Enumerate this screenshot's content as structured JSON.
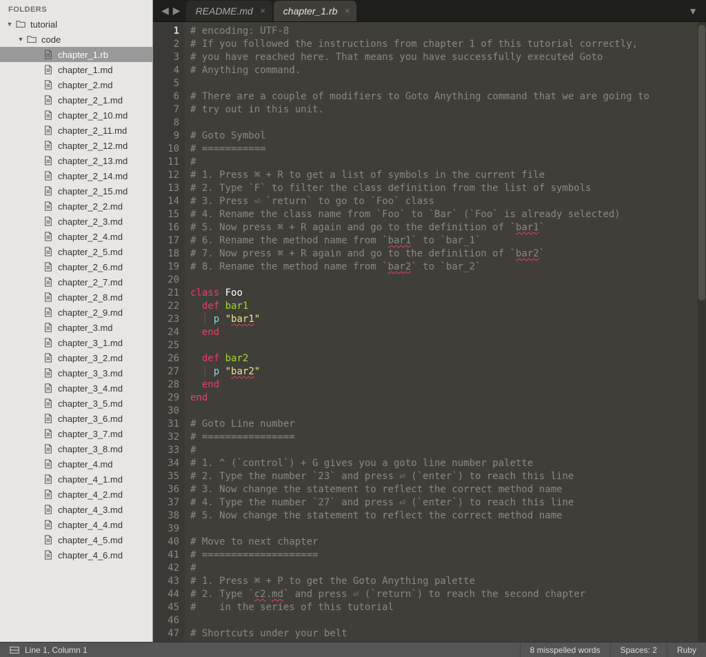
{
  "sidebar": {
    "heading": "FOLDERS",
    "tree": {
      "root": {
        "name": "tutorial",
        "expanded": true
      },
      "code": {
        "name": "code",
        "expanded": true
      },
      "selected_file": "chapter_1.rb",
      "files": [
        "chapter_1.rb",
        "chapter_1.md",
        "chapter_2.md",
        "chapter_2_1.md",
        "chapter_2_10.md",
        "chapter_2_11.md",
        "chapter_2_12.md",
        "chapter_2_13.md",
        "chapter_2_14.md",
        "chapter_2_15.md",
        "chapter_2_2.md",
        "chapter_2_3.md",
        "chapter_2_4.md",
        "chapter_2_5.md",
        "chapter_2_6.md",
        "chapter_2_7.md",
        "chapter_2_8.md",
        "chapter_2_9.md",
        "chapter_3.md",
        "chapter_3_1.md",
        "chapter_3_2.md",
        "chapter_3_3.md",
        "chapter_3_4.md",
        "chapter_3_5.md",
        "chapter_3_6.md",
        "chapter_3_7.md",
        "chapter_3_8.md",
        "chapter_4.md",
        "chapter_4_1.md",
        "chapter_4_2.md",
        "chapter_4_3.md",
        "chapter_4_4.md",
        "chapter_4_5.md",
        "chapter_4_6.md"
      ]
    }
  },
  "tabs": [
    {
      "label": "README.md",
      "active": false
    },
    {
      "label": "chapter_1.rb",
      "active": true
    }
  ],
  "editor": {
    "first_line": 1,
    "last_line": 47,
    "active_line": 1,
    "lines": [
      {
        "n": 1,
        "html": "<span class='c-comment'># encoding: UTF-8</span>"
      },
      {
        "n": 2,
        "html": "<span class='c-comment'># If you followed the instructions from chapter 1 of this tutorial correctly,</span>"
      },
      {
        "n": 3,
        "html": "<span class='c-comment'># you have reached here. That means you have successfully executed Goto</span>"
      },
      {
        "n": 4,
        "html": "<span class='c-comment'># Anything command.</span>"
      },
      {
        "n": 5,
        "html": ""
      },
      {
        "n": 6,
        "html": "<span class='c-comment'># There are a couple of modifiers to Goto Anything command that we are going to</span>"
      },
      {
        "n": 7,
        "html": "<span class='c-comment'># try out in this unit.</span>"
      },
      {
        "n": 8,
        "html": ""
      },
      {
        "n": 9,
        "html": "<span class='c-comment'># Goto Symbol</span>"
      },
      {
        "n": 10,
        "html": "<span class='c-comment'># ===========</span>"
      },
      {
        "n": 11,
        "html": "<span class='c-comment'>#</span>"
      },
      {
        "n": 12,
        "html": "<span class='c-comment'># 1. Press ⌘ + R to get a list of symbols in the current file</span>"
      },
      {
        "n": 13,
        "html": "<span class='c-comment'># 2. Type `F` to filter the class definition from the list of symbols</span>"
      },
      {
        "n": 14,
        "html": "<span class='c-comment'># 3. Press ⏎ `return` to go to `Foo` class</span>"
      },
      {
        "n": 15,
        "html": "<span class='c-comment'># 4. Rename the class name from `Foo` to `Bar` (`Foo` is already selected)</span>"
      },
      {
        "n": 16,
        "html": "<span class='c-comment'># 5. Now press ⌘ + R again and go to the definition of `<span class='spellerr'>bar1</span>`</span>"
      },
      {
        "n": 17,
        "html": "<span class='c-comment'># 6. Rename the method name from `<span class='spellerr'>bar1</span>` to `bar_1`</span>"
      },
      {
        "n": 18,
        "html": "<span class='c-comment'># 7. Now press ⌘ + R again and go to the definition of `<span class='spellerr'>bar2</span>`</span>"
      },
      {
        "n": 19,
        "html": "<span class='c-comment'># 8. Rename the method name from `<span class='spellerr'>bar2</span>` to `bar_2`</span>"
      },
      {
        "n": 20,
        "html": ""
      },
      {
        "n": 21,
        "html": "<span class='c-keyword'>class</span> <span class='c-class'>Foo</span>"
      },
      {
        "n": 22,
        "html": "  <span class='c-keyword'>def</span> <span class='c-method'>bar1</span>"
      },
      {
        "n": 23,
        "html": "  <span class='indent-guide'>│</span> <span class='c-func'>p</span> <span class='c-string'>\"<span class='spellerr'>bar1</span>\"</span>"
      },
      {
        "n": 24,
        "html": "  <span class='c-keyword'>end</span>"
      },
      {
        "n": 25,
        "html": ""
      },
      {
        "n": 26,
        "html": "  <span class='c-keyword'>def</span> <span class='c-method'>bar2</span>"
      },
      {
        "n": 27,
        "html": "  <span class='indent-guide'>│</span> <span class='c-func'>p</span> <span class='c-string'>\"<span class='spellerr'>bar2</span>\"</span>"
      },
      {
        "n": 28,
        "html": "  <span class='c-keyword'>end</span>"
      },
      {
        "n": 29,
        "html": "<span class='c-keyword'>end</span>"
      },
      {
        "n": 30,
        "html": ""
      },
      {
        "n": 31,
        "html": "<span class='c-comment'># Goto Line number</span>"
      },
      {
        "n": 32,
        "html": "<span class='c-comment'># ================</span>"
      },
      {
        "n": 33,
        "html": "<span class='c-comment'>#</span>"
      },
      {
        "n": 34,
        "html": "<span class='c-comment'># 1. ^ (`control`) + G gives you a goto line number palette</span>"
      },
      {
        "n": 35,
        "html": "<span class='c-comment'># 2. Type the number `23` and press ⏎ (`enter`) to reach this line</span>"
      },
      {
        "n": 36,
        "html": "<span class='c-comment'># 3. Now change the statement to reflect the correct method name</span>"
      },
      {
        "n": 37,
        "html": "<span class='c-comment'># 4. Type the number `27` and press ⏎ (`enter`) to reach this line</span>"
      },
      {
        "n": 38,
        "html": "<span class='c-comment'># 5. Now change the statement to reflect the correct method name</span>"
      },
      {
        "n": 39,
        "html": ""
      },
      {
        "n": 40,
        "html": "<span class='c-comment'># Move to next chapter</span>"
      },
      {
        "n": 41,
        "html": "<span class='c-comment'># ====================</span>"
      },
      {
        "n": 42,
        "html": "<span class='c-comment'>#</span>"
      },
      {
        "n": 43,
        "html": "<span class='c-comment'># 1. Press ⌘ + P to get the Goto Anything palette</span>"
      },
      {
        "n": 44,
        "html": "<span class='c-comment'># 2. Type `<span class='spellerr'>c2</span>.<span class='spellerr'>md</span>` and press ⏎ (`return`) to reach the second chapter</span>"
      },
      {
        "n": 45,
        "html": "<span class='c-comment'>#    in the series of this tutorial</span>"
      },
      {
        "n": 46,
        "html": ""
      },
      {
        "n": 47,
        "html": "<span class='c-comment'># Shortcuts under your belt</span>"
      }
    ]
  },
  "status": {
    "position": "Line 1, Column 1",
    "spell": "8 misspelled words",
    "indent": "Spaces: 2",
    "syntax": "Ruby"
  }
}
